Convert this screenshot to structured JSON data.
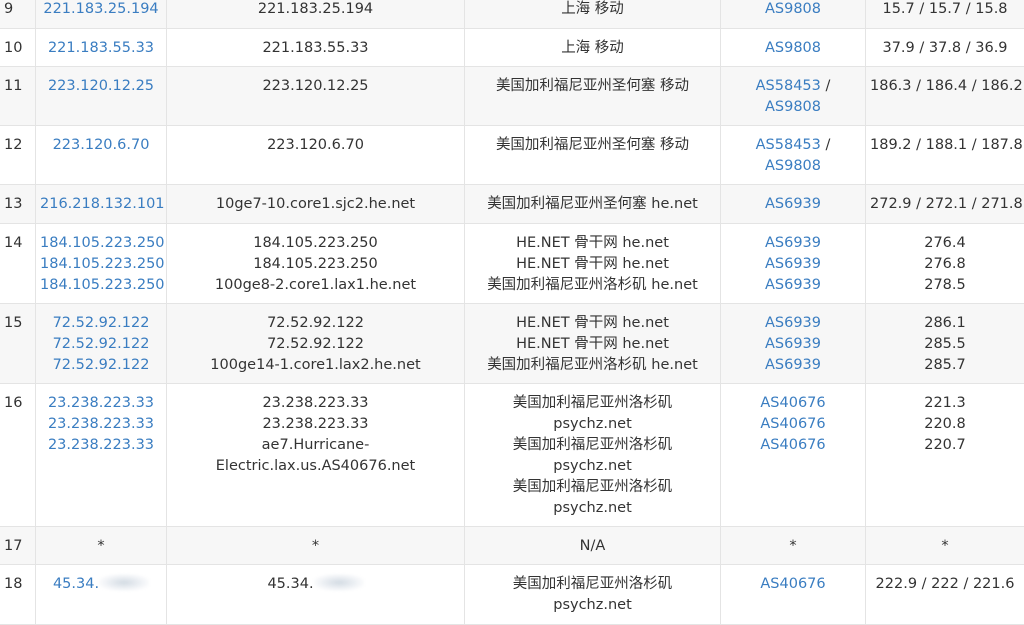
{
  "hops": [
    {
      "hop": "9",
      "ips": [
        "221.183.25.194"
      ],
      "hosts": [
        "221.183.25.194"
      ],
      "locs": [
        "上海 移动"
      ],
      "as": [
        [
          "AS9808"
        ]
      ],
      "times": [
        "15.7 / 15.7 / 15.8"
      ]
    },
    {
      "hop": "10",
      "ips": [
        "221.183.55.33"
      ],
      "hosts": [
        "221.183.55.33"
      ],
      "locs": [
        "上海 移动"
      ],
      "as": [
        [
          "AS9808"
        ]
      ],
      "times": [
        "37.9 / 37.8 / 36.9"
      ]
    },
    {
      "hop": "11",
      "ips": [
        "223.120.12.25"
      ],
      "hosts": [
        "223.120.12.25"
      ],
      "locs": [
        "美国加利福尼亚州圣何塞 移动"
      ],
      "as": [
        [
          "AS58453",
          "AS9808"
        ]
      ],
      "times": [
        "186.3 / 186.4 / 186.2"
      ]
    },
    {
      "hop": "12",
      "ips": [
        "223.120.6.70"
      ],
      "hosts": [
        "223.120.6.70"
      ],
      "locs": [
        "美国加利福尼亚州圣何塞 移动"
      ],
      "as": [
        [
          "AS58453",
          "AS9808"
        ]
      ],
      "times": [
        "189.2 / 188.1 / 187.8"
      ]
    },
    {
      "hop": "13",
      "ips": [
        "216.218.132.101"
      ],
      "hosts": [
        "10ge7-10.core1.sjc2.he.net"
      ],
      "locs": [
        "美国加利福尼亚州圣何塞 he.net"
      ],
      "as": [
        [
          "AS6939"
        ]
      ],
      "times": [
        "272.9 / 272.1 / 271.8"
      ]
    },
    {
      "hop": "14",
      "ips": [
        "184.105.223.250",
        "184.105.223.250",
        "184.105.223.250"
      ],
      "hosts": [
        "184.105.223.250",
        "184.105.223.250",
        "100ge8-2.core1.lax1.he.net"
      ],
      "locs": [
        "HE.NET 骨干网 he.net",
        "HE.NET 骨干网 he.net",
        "美国加利福尼亚州洛杉矶 he.net"
      ],
      "as": [
        [
          "AS6939"
        ],
        [
          "AS6939"
        ],
        [
          "AS6939"
        ]
      ],
      "times": [
        "276.4",
        "276.8",
        "278.5"
      ]
    },
    {
      "hop": "15",
      "ips": [
        "72.52.92.122",
        "72.52.92.122",
        "72.52.92.122"
      ],
      "hosts": [
        "72.52.92.122",
        "72.52.92.122",
        "100ge14-1.core1.lax2.he.net"
      ],
      "locs": [
        "HE.NET 骨干网 he.net",
        "HE.NET 骨干网 he.net",
        "美国加利福尼亚州洛杉矶 he.net"
      ],
      "as": [
        [
          "AS6939"
        ],
        [
          "AS6939"
        ],
        [
          "AS6939"
        ]
      ],
      "times": [
        "286.1",
        "285.5",
        "285.7"
      ]
    },
    {
      "hop": "16",
      "ips": [
        "23.238.223.33",
        "23.238.223.33",
        "23.238.223.33"
      ],
      "hosts": [
        "23.238.223.33",
        "23.238.223.33",
        "ae7.Hurricane-",
        "Electric.lax.us.AS40676.net"
      ],
      "locs": [
        "美国加利福尼亚州洛杉矶",
        "psychz.net",
        "美国加利福尼亚州洛杉矶",
        "psychz.net",
        "美国加利福尼亚州洛杉矶",
        "psychz.net"
      ],
      "as": [
        [
          "AS40676"
        ],
        [
          "AS40676"
        ],
        [
          "AS40676"
        ]
      ],
      "times": [
        "221.3",
        "220.8",
        "220.7"
      ]
    },
    {
      "hop": "17",
      "ips": [
        "*"
      ],
      "ips_plain": true,
      "hosts": [
        "*"
      ],
      "locs": [
        "N/A"
      ],
      "as": [
        [
          "*"
        ]
      ],
      "as_plain": true,
      "times": [
        "*"
      ]
    },
    {
      "hop": "18",
      "ips": [
        "45.34."
      ],
      "ip_redacted": true,
      "hosts": [
        "45.34."
      ],
      "host_redacted": true,
      "locs": [
        "美国加利福尼亚州洛杉矶",
        "psychz.net"
      ],
      "as": [
        [
          "AS40676"
        ]
      ],
      "times": [
        "222.9 / 222 / 221.6"
      ]
    }
  ],
  "row_heights": null
}
